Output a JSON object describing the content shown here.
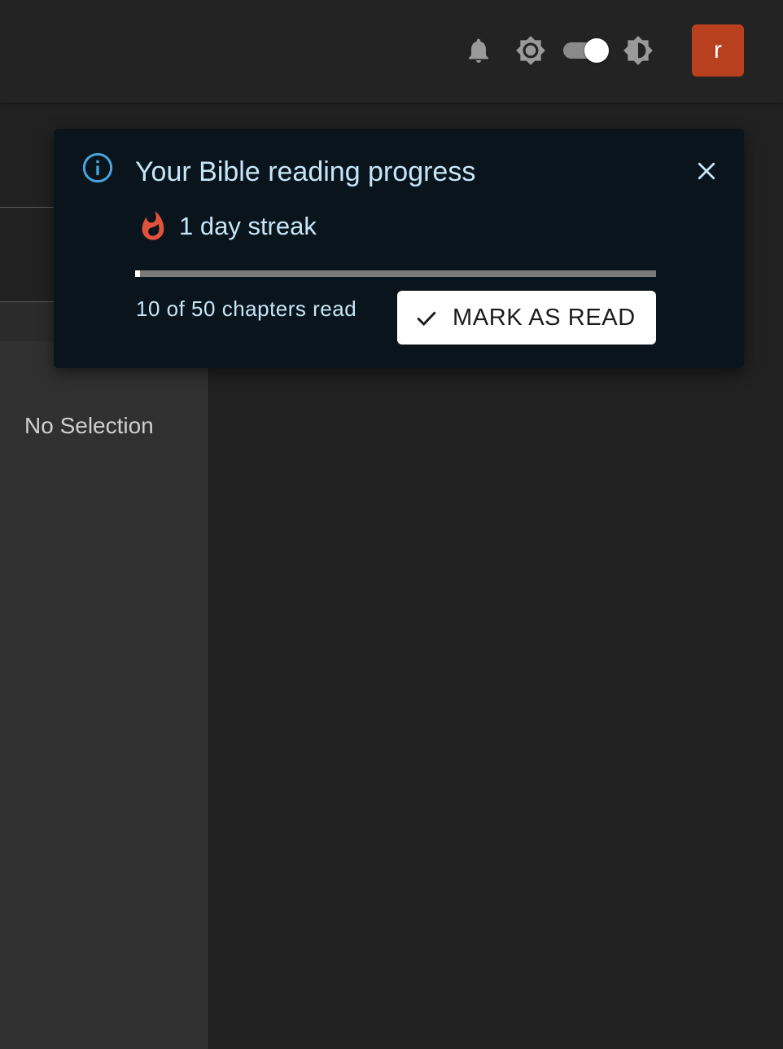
{
  "header": {
    "notifications_icon": "bell-icon",
    "light_theme_icon": "sun-icon",
    "theme_toggle_on": true,
    "dark_theme_icon": "contrast-icon",
    "avatar_letter": "r",
    "avatar_color": "#b8401f"
  },
  "sidebar": {
    "empty_label": "No Selection"
  },
  "reading_alert": {
    "title": "Your Bible reading progress",
    "info_icon": "info-icon",
    "close_icon": "close-icon",
    "streak_icon": "flame-icon",
    "streak_text": "1 day streak",
    "chapters_text": "10 of 50 chapters read",
    "progress_fraction": 0.01,
    "mark_button_label": "MARK AS READ",
    "mark_button_icon": "check-icon",
    "accent_color": "#4aa3df",
    "flame_color": "#e0523c"
  }
}
